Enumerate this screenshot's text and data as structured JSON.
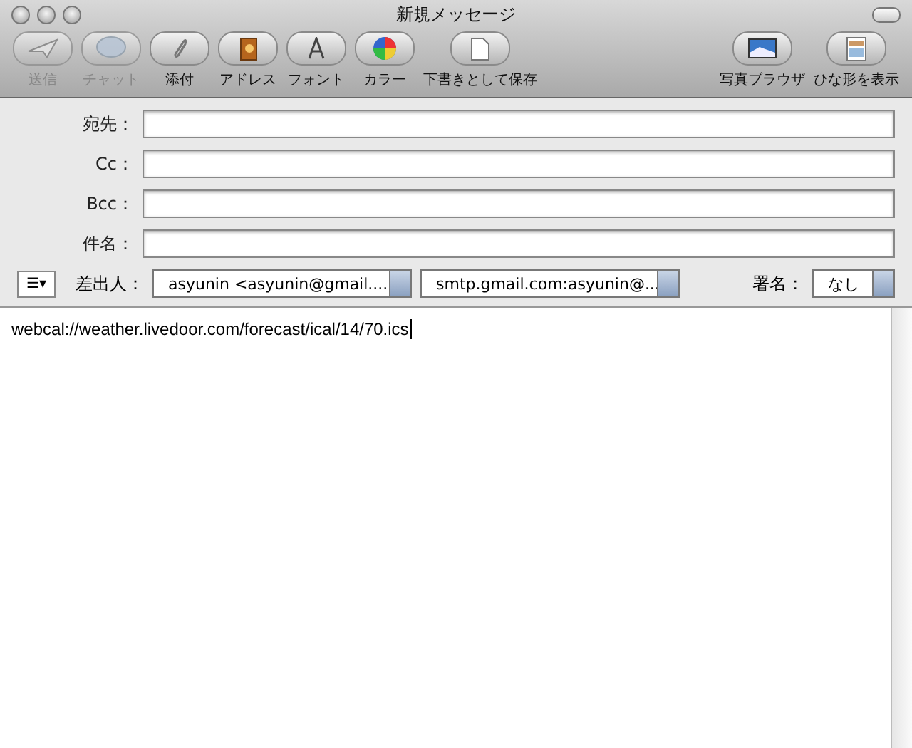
{
  "window": {
    "title": "新規メッセージ"
  },
  "toolbar": {
    "left": [
      {
        "kind": "send",
        "label": "送信",
        "disabled": true
      },
      {
        "kind": "chat",
        "label": "チャット",
        "disabled": true
      },
      {
        "kind": "attach",
        "label": "添付",
        "disabled": false
      },
      {
        "kind": "address",
        "label": "アドレス",
        "disabled": false
      },
      {
        "kind": "font",
        "label": "フォント",
        "disabled": false
      },
      {
        "kind": "color",
        "label": "カラー",
        "disabled": false
      },
      {
        "kind": "draft",
        "label": "下書きとして保存",
        "disabled": false
      }
    ],
    "right": [
      {
        "kind": "photo",
        "label": "写真ブラウザ",
        "disabled": false
      },
      {
        "kind": "template",
        "label": "ひな形を表示",
        "disabled": false
      }
    ]
  },
  "fields": [
    {
      "label": "宛先："
    },
    {
      "label": "Cc："
    },
    {
      "label": "Bcc："
    },
    {
      "label": "件名："
    }
  ],
  "from_row": {
    "menu_button": "☰▾",
    "label": "差出人：",
    "account": "asyunin <asyunin@gmail....",
    "server": "smtp.gmail.com:asyunin@...",
    "signature_label": "署名：",
    "signature": "なし"
  },
  "body": {
    "text": "webcal://weather.livedoor.com/forecast/ical/14/70.ics"
  }
}
